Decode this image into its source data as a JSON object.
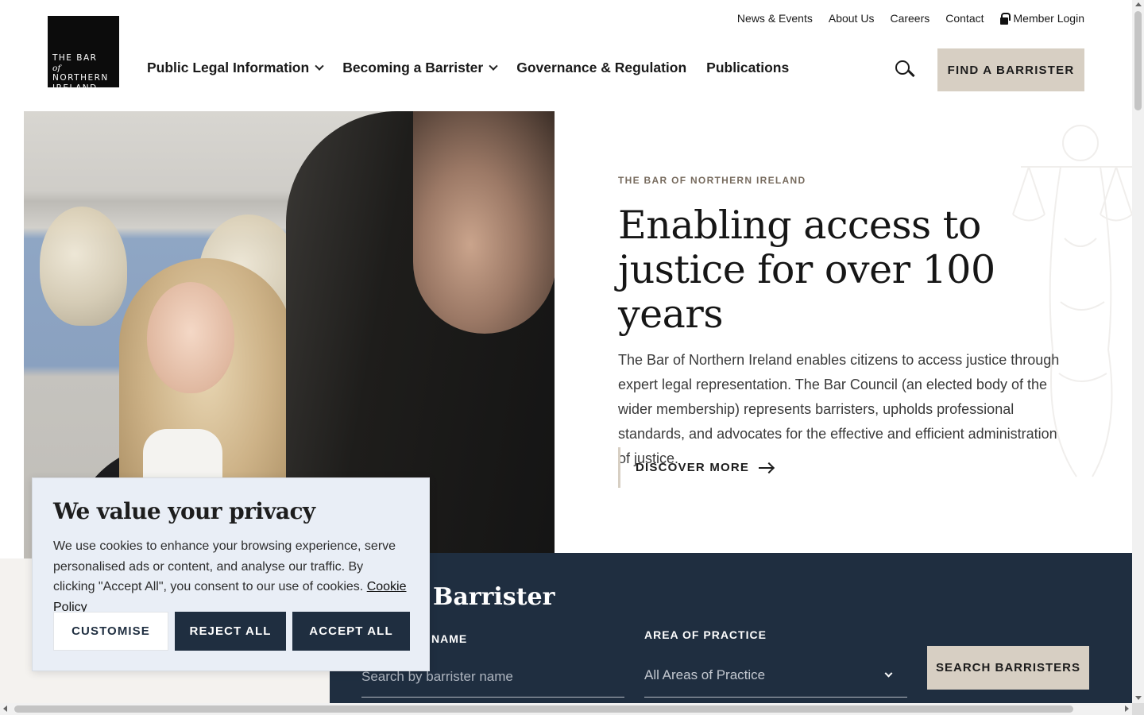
{
  "header": {
    "logo": {
      "line1": "THE BAR",
      "line1_of": "of",
      "line2": "NORTHERN",
      "line3": "IRELAND"
    },
    "utility_nav": [
      "News & Events",
      "About Us",
      "Careers",
      "Contact"
    ],
    "member_login": "Member Login",
    "main_nav": [
      {
        "label": "Public Legal Information",
        "has_dropdown": true
      },
      {
        "label": "Becoming a Barrister",
        "has_dropdown": true
      },
      {
        "label": "Governance & Regulation",
        "has_dropdown": false
      },
      {
        "label": "Publications",
        "has_dropdown": false
      }
    ],
    "search_icon": "search-icon",
    "find_button": "FIND A BARRISTER"
  },
  "hero": {
    "eyebrow": "THE BAR OF NORTHERN IRELAND",
    "title": "Enabling access to justice for over 100 years",
    "body": "The Bar of Northern Ireland enables citizens to access justice through expert legal representation. The Bar Council (an elected body of the wider membership) represents barristers, upholds professional standards, and advocates for the effective and efficient administration of justice.",
    "cta": "DISCOVER MORE"
  },
  "find_barrister": {
    "title": "Barrister",
    "name_label": "NAME",
    "name_placeholder": "Search by barrister name",
    "area_label": "AREA OF PRACTICE",
    "area_selected": "All Areas of Practice",
    "search_button": "SEARCH BARRISTERS"
  },
  "cookie_banner": {
    "title": "We value your privacy",
    "text": "We use cookies to enhance your browsing experience, serve personalised ads or content, and analyse our traffic. By clicking \"Accept All\", you consent to our use of cookies.",
    "policy_link": "Cookie Policy",
    "customise": "CUSTOMISE",
    "reject": "REJECT ALL",
    "accept": "ACCEPT ALL"
  },
  "colors": {
    "navy": "#1f2e40",
    "beige_button": "#d7cfc3",
    "cookie_bg": "#e9eef6",
    "eyebrow": "#776b5e"
  }
}
